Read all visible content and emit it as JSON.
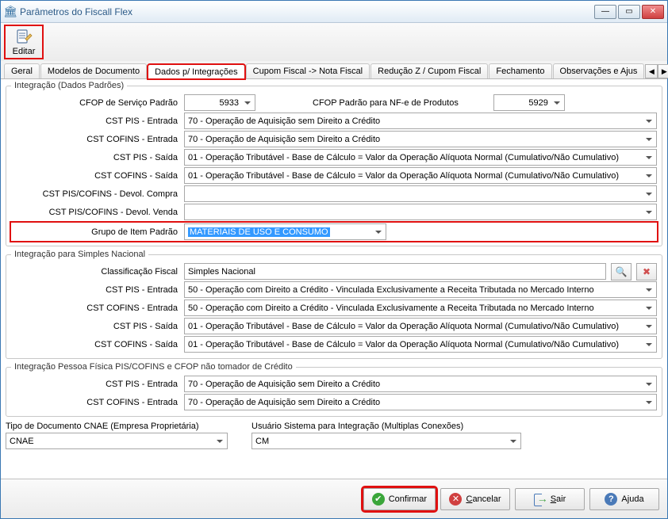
{
  "window": {
    "title": "Parâmetros do Fiscall Flex"
  },
  "toolbar": {
    "editar_label": "Editar"
  },
  "tabs": {
    "geral": "Geral",
    "modelos": "Modelos de Documento",
    "dados_int": "Dados p/ Integrações",
    "cupom_nf": "Cupom Fiscal -> Nota Fiscal",
    "reducao": "Redução Z / Cupom Fiscal",
    "fechamento": "Fechamento",
    "obs": "Observações e Ajus"
  },
  "grp1": {
    "legend": "Integração (Dados Padrões)",
    "cfop_servico_lbl": "CFOP de Serviço Padrão",
    "cfop_servico_val": "5933",
    "cfop_nfe_lbl": "CFOP Padrão para NF-e de Produtos",
    "cfop_nfe_val": "5929",
    "cst_pis_ent_lbl": "CST PIS - Entrada",
    "cst_pis_ent_val": "70 - Operação de Aquisição sem Direito a Crédito",
    "cst_cofins_ent_lbl": "CST COFINS - Entrada",
    "cst_cofins_ent_val": "70 - Operação de Aquisição sem Direito a Crédito",
    "cst_pis_sai_lbl": "CST PIS - Saída",
    "cst_pis_sai_val": "01 - Operação Tributável - Base de Cálculo = Valor da Operação Alíquota Normal (Cumulativo/Não Cumulativo)",
    "cst_cofins_sai_lbl": "CST COFINS - Saída",
    "cst_cofins_sai_val": "01 - Operação Tributável - Base de Cálculo = Valor da Operação Alíquota Normal (Cumulativo/Não Cumulativo)",
    "devol_compra_lbl": "CST PIS/COFINS - Devol. Compra",
    "devol_compra_val": "",
    "devol_venda_lbl": "CST PIS/COFINS - Devol. Venda",
    "devol_venda_val": "",
    "grupo_item_lbl": "Grupo de Item Padrão",
    "grupo_item_val": "MATERIAIS DE USO E CONSUMO"
  },
  "grp2": {
    "legend": "Integração para Simples Nacional",
    "clas_fisc_lbl": "Classificação Fiscal",
    "clas_fisc_val": "Simples Nacional",
    "cst_pis_ent_lbl": "CST PIS - Entrada",
    "cst_pis_ent_val": "50 - Operação com Direito a Crédito - Vinculada Exclusivamente a Receita Tributada no Mercado Interno",
    "cst_cofins_ent_lbl": "CST COFINS - Entrada",
    "cst_cofins_ent_val": "50 - Operação com Direito a Crédito - Vinculada Exclusivamente a Receita Tributada no Mercado Interno",
    "cst_pis_sai_lbl": "CST PIS - Saída",
    "cst_pis_sai_val": "01 - Operação Tributável - Base de Cálculo = Valor da Operação Alíquota Normal (Cumulativo/Não Cumulativo)",
    "cst_cofins_sai_lbl": "CST COFINS - Saída",
    "cst_cofins_sai_val": "01 - Operação Tributável - Base de Cálculo = Valor da Operação Alíquota Normal (Cumulativo/Não Cumulativo)"
  },
  "grp3": {
    "legend": "Integração Pessoa Física PIS/COFINS  e  CFOP não tomador de Crédito",
    "cst_pis_ent_lbl": "CST PIS - Entrada",
    "cst_pis_ent_val": "70 - Operação de Aquisição sem Direito a Crédito",
    "cst_cofins_ent_lbl": "CST COFINS - Entrada",
    "cst_cofins_ent_val": "70 - Operação de Aquisição sem Direito a Crédito"
  },
  "bottom": {
    "tipo_doc_lbl": "Tipo de Documento CNAE (Empresa Proprietária)",
    "tipo_doc_val": "CNAE",
    "usuario_lbl": "Usuário Sistema para Integração (Multiplas Conexões)",
    "usuario_val": "CM"
  },
  "footer": {
    "confirmar": "Confirmar",
    "cancelar": "Cancelar",
    "sair": "Sair",
    "ajuda": "Ajuda"
  }
}
